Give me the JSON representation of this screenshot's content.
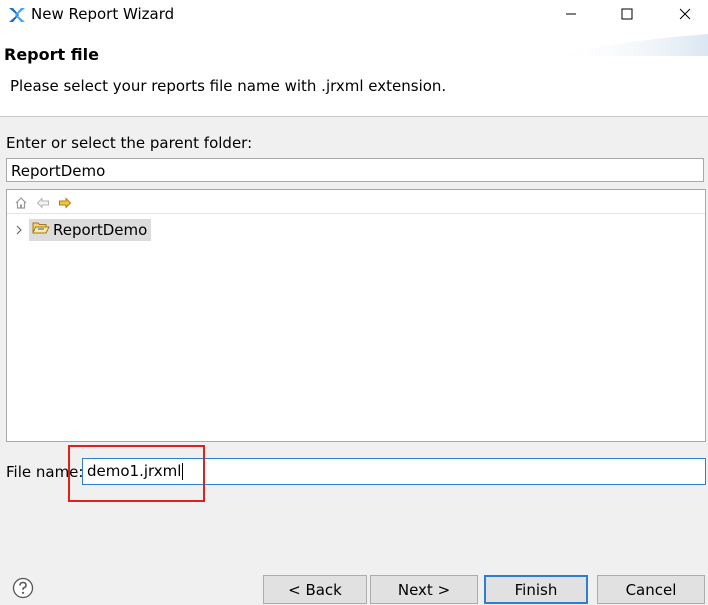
{
  "window": {
    "title": "New Report Wizard",
    "app_icon": "jaspersoft-logo-icon",
    "controls": [
      "minimize-icon",
      "maximize-icon",
      "close-icon"
    ]
  },
  "header": {
    "title": "Report file",
    "message": "Please select your reports file name with .jrxml extension."
  },
  "parent_folder": {
    "label": "Enter or select the parent folder:",
    "value": "ReportDemo"
  },
  "tree": {
    "toolbar": [
      "home-icon",
      "back-arrow-icon",
      "forward-arrow-icon"
    ],
    "items": [
      {
        "label": "ReportDemo",
        "icon": "open-folder-icon",
        "selected": true,
        "expandable": true
      }
    ]
  },
  "file_name": {
    "label": "File name:",
    "value": "demo1.jrxml"
  },
  "buttons": {
    "help": "help-icon",
    "back": "< Back",
    "next": "Next >",
    "finish": "Finish",
    "cancel": "Cancel"
  },
  "colors": {
    "accent": "#2f7fd0",
    "highlight": "#e02020",
    "selection": "#dcdcdc"
  }
}
